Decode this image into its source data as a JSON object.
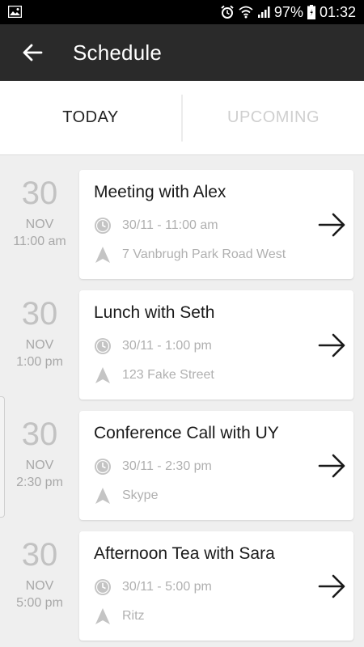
{
  "status_bar": {
    "battery_percent": "97%",
    "time": "01:32",
    "icons": [
      "image-icon",
      "alarm-icon",
      "wifi-icon",
      "signal-icon",
      "battery-icon"
    ]
  },
  "app_bar": {
    "title": "Schedule",
    "back_icon": "arrow-left-icon"
  },
  "tabs": [
    {
      "label": "TODAY",
      "active": true
    },
    {
      "label": "UPCOMING",
      "active": false
    }
  ],
  "events": [
    {
      "day": "30",
      "month": "NOV",
      "time": "11:00 am",
      "title": "Meeting with Alex",
      "datetime": "30/11 - 11:00 am",
      "location": "7 Vanbrugh Park Road West"
    },
    {
      "day": "30",
      "month": "NOV",
      "time": "1:00 pm",
      "title": "Lunch with Seth",
      "datetime": "30/11 - 1:00 pm",
      "location": "123 Fake Street"
    },
    {
      "day": "30",
      "month": "NOV",
      "time": "2:30 pm",
      "title": "Conference Call with UY",
      "datetime": "30/11 - 2:30 pm",
      "location": "Skype"
    },
    {
      "day": "30",
      "month": "NOV",
      "time": "5:00 pm",
      "title": "Afternoon Tea with Sara",
      "datetime": "30/11 - 5:00 pm",
      "location": "Ritz"
    }
  ],
  "colors": {
    "status_bar_bg": "#000000",
    "app_bar_bg": "#2a2a2a",
    "page_bg": "#efefef",
    "tab_active": "#222222",
    "tab_inactive": "#cfcfcf"
  }
}
